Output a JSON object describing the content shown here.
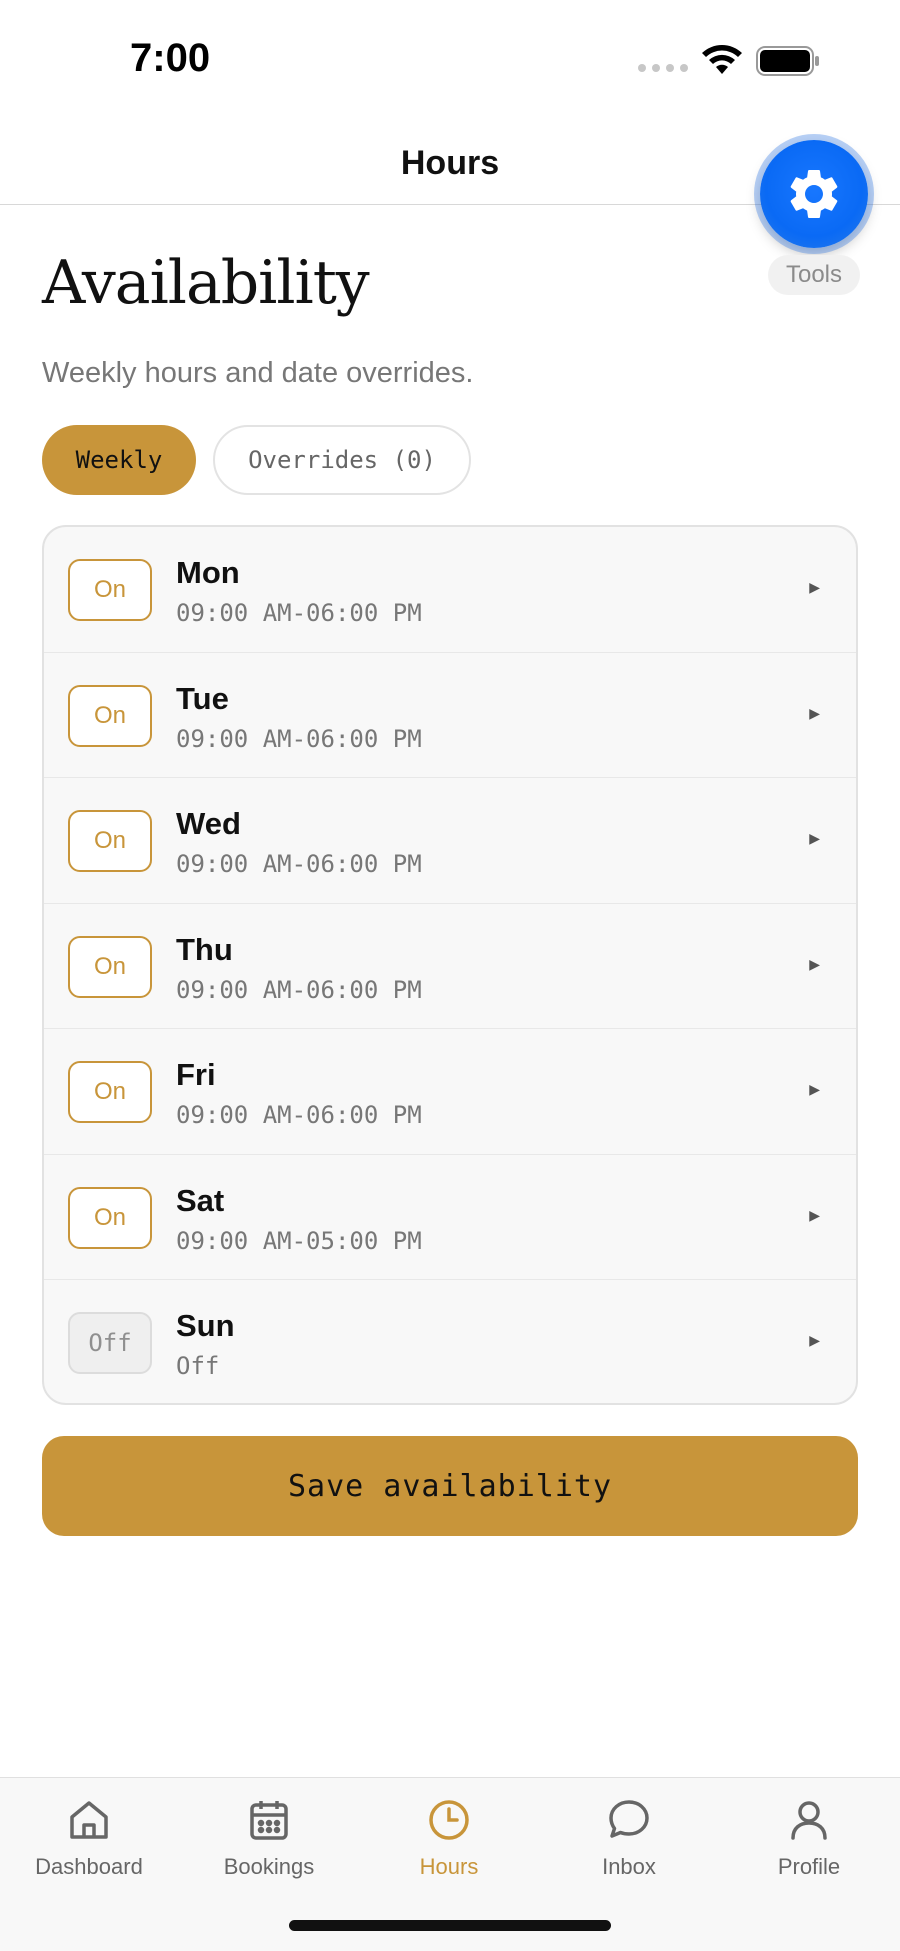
{
  "status_bar": {
    "time": "7:00"
  },
  "header": {
    "title": "Hours"
  },
  "tools": {
    "label": "Tools"
  },
  "page": {
    "title": "Availability",
    "subtitle": "Weekly hours and date overrides."
  },
  "tabs": [
    {
      "label": "Weekly",
      "active": true
    },
    {
      "label": "Overrides (0)",
      "active": false
    }
  ],
  "days": [
    {
      "toggle": "On",
      "name": "Mon",
      "hours": "09:00 AM-06:00 PM"
    },
    {
      "toggle": "On",
      "name": "Tue",
      "hours": "09:00 AM-06:00 PM"
    },
    {
      "toggle": "On",
      "name": "Wed",
      "hours": "09:00 AM-06:00 PM"
    },
    {
      "toggle": "On",
      "name": "Thu",
      "hours": "09:00 AM-06:00 PM"
    },
    {
      "toggle": "On",
      "name": "Fri",
      "hours": "09:00 AM-06:00 PM"
    },
    {
      "toggle": "On",
      "name": "Sat",
      "hours": "09:00 AM-05:00 PM"
    },
    {
      "toggle": "Off",
      "name": "Sun",
      "hours": "Off"
    }
  ],
  "save_button": {
    "label": "Save availability"
  },
  "tabbar": [
    {
      "label": "Dashboard",
      "icon": "home-icon",
      "active": false
    },
    {
      "label": "Bookings",
      "icon": "calendar-icon",
      "active": false
    },
    {
      "label": "Hours",
      "icon": "clock-icon",
      "active": true
    },
    {
      "label": "Inbox",
      "icon": "chat-bubble-icon",
      "active": false
    },
    {
      "label": "Profile",
      "icon": "person-icon",
      "active": false
    }
  ],
  "colors": {
    "accent": "#c8953a",
    "fab_blue": "#0a6af5"
  }
}
